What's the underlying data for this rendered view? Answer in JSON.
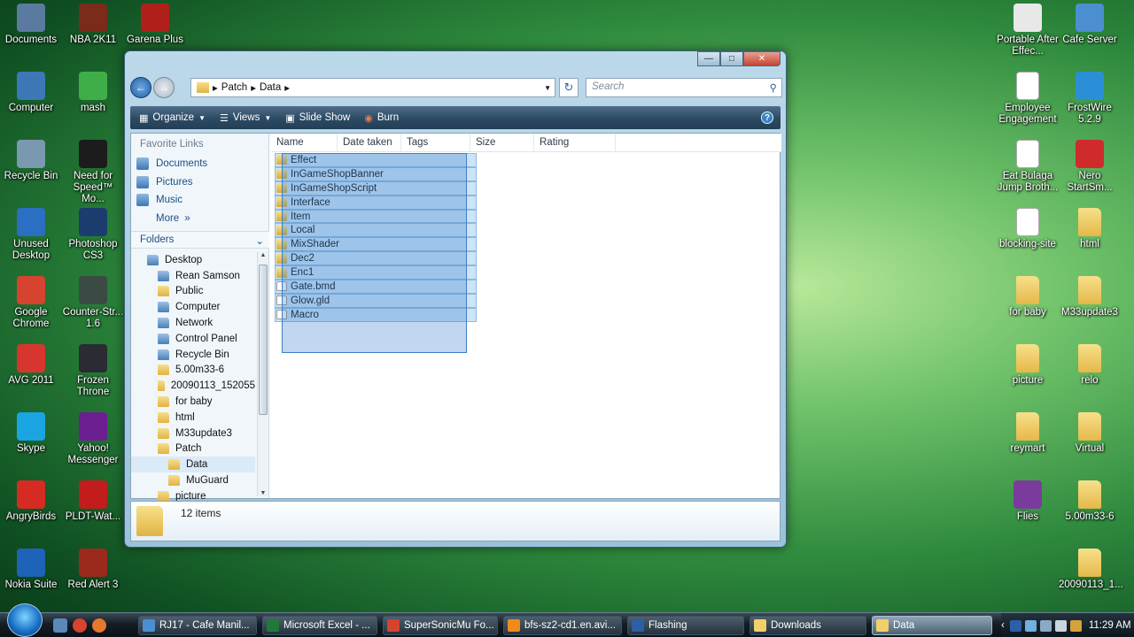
{
  "desktop": {
    "left_icons": [
      {
        "label": "Documents",
        "icon": "documents-icon",
        "color": "#5a7aa0"
      },
      {
        "label": "NBA 2K11",
        "icon": "nba-icon",
        "color": "#7a2b1a"
      },
      {
        "label": "Garena Plus",
        "icon": "garena-icon",
        "color": "#b0201b"
      },
      {
        "label": "Computer",
        "icon": "computer-icon",
        "color": "#3b78b5"
      },
      {
        "label": "mash",
        "icon": "mash-icon",
        "color": "#3fae49"
      },
      {
        "label": "Recycle Bin",
        "icon": "recycle-bin-icon",
        "color": "#7a98b0"
      },
      {
        "label": "Need for Speed™ Mo...",
        "icon": "nfs-icon",
        "color": "#1c1c1c"
      },
      {
        "label": "Unused Desktop",
        "icon": "help-icon",
        "color": "#2a6fc1"
      },
      {
        "label": "Photoshop CS3",
        "icon": "photoshop-icon",
        "color": "#1b3d6e"
      },
      {
        "label": "Google Chrome",
        "icon": "chrome-icon",
        "color": "#d6432f"
      },
      {
        "label": "Counter-Str... 1.6",
        "icon": "counter-strike-icon",
        "color": "#3b4a45"
      },
      {
        "label": "AVG 2011",
        "icon": "avg-icon",
        "color": "#d7362e"
      },
      {
        "label": "Frozen Throne",
        "icon": "frozen-throne-icon",
        "color": "#2b2b33"
      },
      {
        "label": "Skype",
        "icon": "skype-icon",
        "color": "#1aa4e2"
      },
      {
        "label": "Yahoo! Messenger",
        "icon": "yahoo-icon",
        "color": "#6b1f91"
      },
      {
        "label": "AngryBirds",
        "icon": "angrybirds-icon",
        "color": "#d52b23"
      },
      {
        "label": "PLDT-Wat...",
        "icon": "pldt-icon",
        "color": "#c21c1c"
      },
      {
        "label": "Nokia Suite",
        "icon": "nokia-icon",
        "color": "#1d63b8"
      },
      {
        "label": "Red Alert 3",
        "icon": "red-alert-icon",
        "color": "#9b2a1c"
      }
    ],
    "right_icons": [
      {
        "label": "Portable After Effec...",
        "icon": "after-effects-icon",
        "color": "#e8e8e8"
      },
      {
        "label": "Cafe Server",
        "icon": "cafe-server-icon",
        "color": "#4b8fd1"
      },
      {
        "label": "Employee Engagement",
        "icon": "document-icon",
        "color": "#ffffff"
      },
      {
        "label": "FrostWire 5.2.9",
        "icon": "frostwire-icon",
        "color": "#2b8fd8"
      },
      {
        "label": "Eat Bulaga Jump Broth...",
        "icon": "mp3-icon",
        "color": "#ffffff"
      },
      {
        "label": "Nero StartSm...",
        "icon": "nero-icon",
        "color": "#cf2b2b"
      },
      {
        "label": "blocking-site",
        "icon": "document-icon",
        "color": "#ffffff"
      },
      {
        "label": "html",
        "icon": "folder-icon",
        "color": "#f2cf6a"
      },
      {
        "label": "for baby",
        "icon": "folder-icon",
        "color": "#f2cf6a"
      },
      {
        "label": "M33update3",
        "icon": "folder-icon",
        "color": "#f2cf6a"
      },
      {
        "label": "picture",
        "icon": "folder-icon",
        "color": "#f2cf6a"
      },
      {
        "label": "relo",
        "icon": "folder-icon",
        "color": "#f2cf6a"
      },
      {
        "label": "reymart",
        "icon": "folder-icon",
        "color": "#f2cf6a"
      },
      {
        "label": "Virtual",
        "icon": "folder-icon",
        "color": "#f2cf6a"
      },
      {
        "label": "Flies",
        "icon": "winrar-icon",
        "color": "#7b3b9c"
      },
      {
        "label": "5.00m33-6",
        "icon": "folder-icon",
        "color": "#f2cf6a"
      },
      {
        "label": "20090113_1...",
        "icon": "folder-icon",
        "color": "#f2cf6a"
      }
    ]
  },
  "window": {
    "breadcrumb": [
      "Patch",
      "Data"
    ],
    "search_placeholder": "Search",
    "toolbar": {
      "organize": "Organize",
      "views": "Views",
      "slideshow": "Slide Show",
      "burn": "Burn"
    },
    "nav": {
      "favorite_title": "Favorite Links",
      "favorites": [
        "Documents",
        "Pictures",
        "Music"
      ],
      "more": "More",
      "folders_title": "Folders",
      "tree": [
        {
          "label": "Desktop",
          "level": 0,
          "sys": true
        },
        {
          "label": "Rean Samson",
          "level": 1,
          "sys": true
        },
        {
          "label": "Public",
          "level": 1,
          "sys": false
        },
        {
          "label": "Computer",
          "level": 1,
          "sys": true
        },
        {
          "label": "Network",
          "level": 1,
          "sys": true
        },
        {
          "label": "Control Panel",
          "level": 1,
          "sys": true
        },
        {
          "label": "Recycle Bin",
          "level": 1,
          "sys": true
        },
        {
          "label": "5.00m33-6",
          "level": 1,
          "sys": false
        },
        {
          "label": "20090113_152055",
          "level": 1,
          "sys": false
        },
        {
          "label": "for baby",
          "level": 1,
          "sys": false
        },
        {
          "label": "html",
          "level": 1,
          "sys": false
        },
        {
          "label": "M33update3",
          "level": 1,
          "sys": false
        },
        {
          "label": "Patch",
          "level": 1,
          "sys": false
        },
        {
          "label": "Data",
          "level": 2,
          "sys": false,
          "selected": true
        },
        {
          "label": "MuGuard",
          "level": 2,
          "sys": false
        },
        {
          "label": "picture",
          "level": 1,
          "sys": false
        }
      ]
    },
    "columns": [
      "Name",
      "Date taken",
      "Tags",
      "Size",
      "Rating"
    ],
    "files": [
      {
        "name": "Effect",
        "type": "folder"
      },
      {
        "name": "InGameShopBanner",
        "type": "folder"
      },
      {
        "name": "InGameShopScript",
        "type": "folder"
      },
      {
        "name": "Interface",
        "type": "folder"
      },
      {
        "name": "Item",
        "type": "folder"
      },
      {
        "name": "Local",
        "type": "folder"
      },
      {
        "name": "MixShader",
        "type": "folder"
      },
      {
        "name": "Dec2",
        "type": "folder"
      },
      {
        "name": "Enc1",
        "type": "folder"
      },
      {
        "name": "Gate.bmd",
        "type": "file"
      },
      {
        "name": "Glow.gld",
        "type": "file"
      },
      {
        "name": "Macro",
        "type": "file"
      }
    ],
    "details": {
      "item_count": "12 items"
    }
  },
  "taskbar": {
    "tasks": [
      {
        "label": "RJ17 - Cafe Manil...",
        "icon": "network-icon",
        "color": "#4b8fd1"
      },
      {
        "label": "Microsoft Excel - ...",
        "icon": "excel-icon",
        "color": "#1f7a3a"
      },
      {
        "label": "SuperSonicMu Fo...",
        "icon": "chrome-icon",
        "color": "#d6432f"
      },
      {
        "label": "bfs-sz2-cd1.en.avi...",
        "icon": "vlc-icon",
        "color": "#f08a1c"
      },
      {
        "label": "Flashing",
        "icon": "app-icon",
        "color": "#2b5fa8"
      },
      {
        "label": "Downloads",
        "icon": "folder-icon",
        "color": "#f2cf6a"
      },
      {
        "label": "Data",
        "icon": "folder-icon",
        "color": "#f2cf6a",
        "active": true
      }
    ],
    "clock": "11:29 AM"
  }
}
